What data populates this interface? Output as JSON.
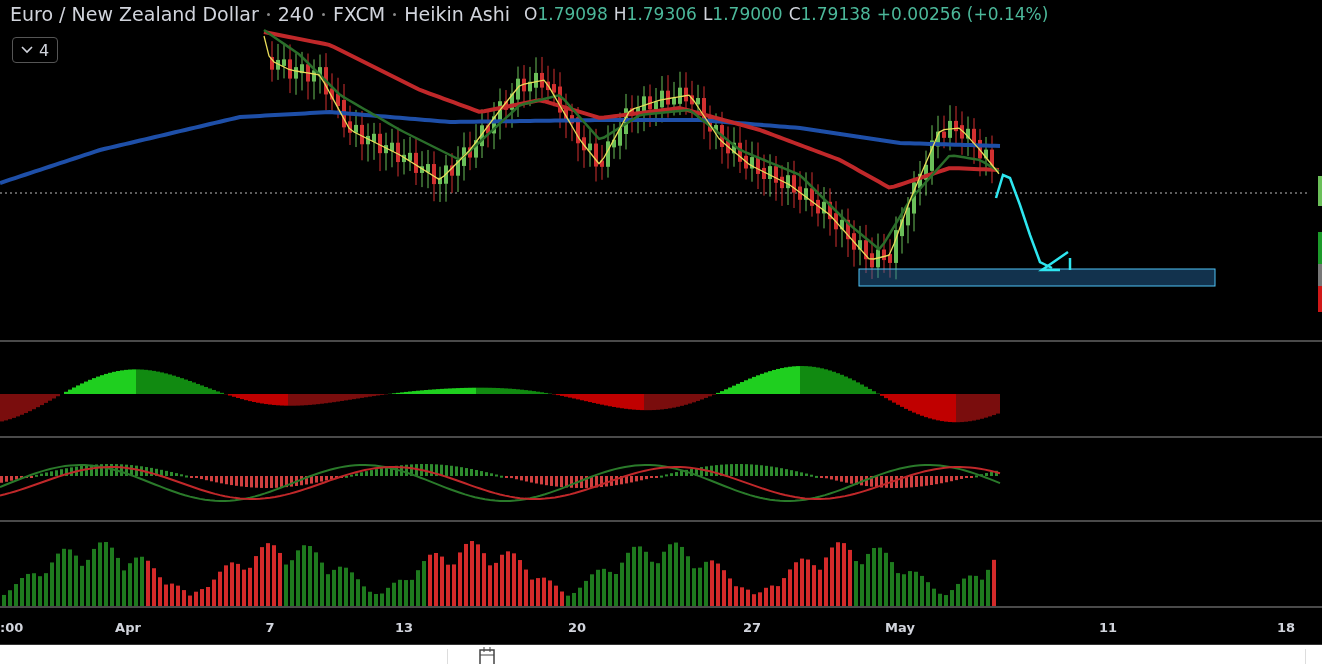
{
  "legend": {
    "symbol": "Euro / New Zealand Dollar",
    "interval": "240",
    "exchange": "FXCM",
    "chart_type": "Heikin Ashi",
    "ohlc": [
      {
        "label": "O",
        "value": "1.79098"
      },
      {
        "label": "H",
        "value": "1.79306"
      },
      {
        "label": "L",
        "value": "1.79000"
      },
      {
        "label": "C",
        "value": "1.79138"
      }
    ],
    "change": "+0.00256 (+0.14%)"
  },
  "indicators_toggle": {
    "count": "4"
  },
  "time_axis": [
    ":00",
    "Apr",
    "7",
    "13",
    "20",
    "27",
    "May",
    "11",
    "18"
  ]
}
